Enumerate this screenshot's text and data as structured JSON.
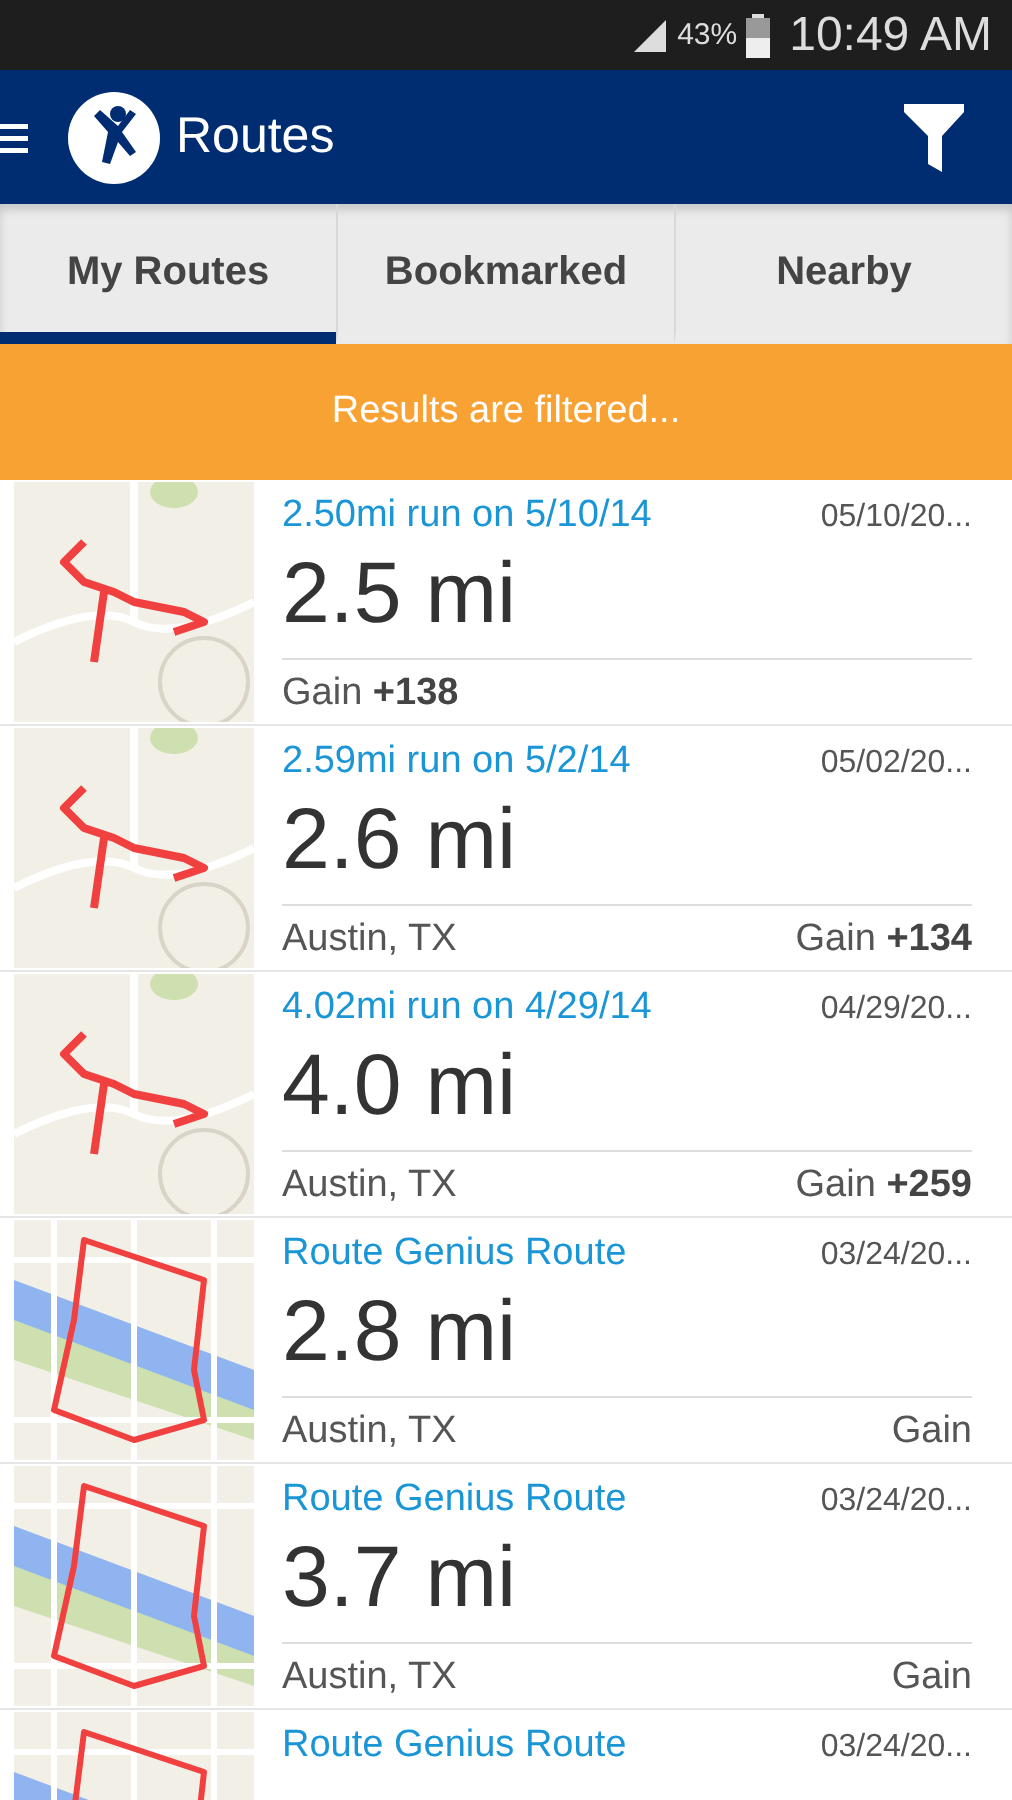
{
  "status_bar": {
    "battery": "43%",
    "time": "10:49 AM"
  },
  "app_bar": {
    "title": "Routes"
  },
  "tabs": [
    {
      "label": "My Routes",
      "selected": true
    },
    {
      "label": "Bookmarked",
      "selected": false
    },
    {
      "label": "Nearby",
      "selected": false
    }
  ],
  "banner": "Results are filtered...",
  "routes": [
    {
      "title": "2.50mi run on 5/10/14",
      "date": "05/10/20...",
      "distance": "2.5 mi",
      "gain": "Gain **+138**"
    },
    {
      "title": "2.59mi run on 5/2/14",
      "date": "05/02/20...",
      "distance": "2.6 mi",
      "location": "Austin, TX",
      "gain": "Gain **+134**"
    },
    {
      "title": "4.02mi run on 4/29/14",
      "date": "04/29/20...",
      "distance": "4.0 mi",
      "location": "Austin, TX",
      "gain": "Gain **+259**"
    },
    {
      "title": "Route Genius Route",
      "date": "03/24/20...",
      "distance": "2.8 mi",
      "location": "Austin, TX",
      "gain": "Gain"
    },
    {
      "title": "Route Genius Route",
      "date": "03/24/20...",
      "distance": "3.7 mi",
      "location": "Austin, TX",
      "gain": "Gain"
    },
    {
      "title": "Route Genius Route",
      "date": "03/24/20..."
    }
  ]
}
